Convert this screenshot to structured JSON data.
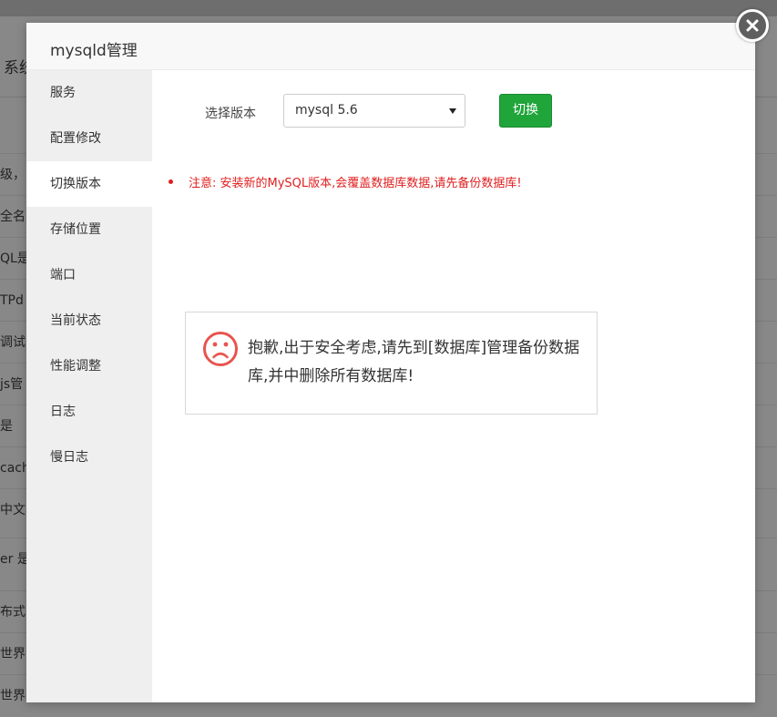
{
  "background": {
    "page_title": "系统",
    "rows": [
      "级，占",
      "全名第",
      "QL是",
      "TPd",
      "调试",
      "js管",
      "是",
      "cach",
      "中文",
      "er 是",
      "布式",
      "世界",
      "世界"
    ]
  },
  "modal": {
    "title": "mysqld管理",
    "close_icon": "close-icon"
  },
  "sidebar": {
    "items": [
      {
        "label": "服务",
        "active": false
      },
      {
        "label": "配置修改",
        "active": false
      },
      {
        "label": "切换版本",
        "active": true
      },
      {
        "label": "存储位置",
        "active": false
      },
      {
        "label": "端口",
        "active": false
      },
      {
        "label": "当前状态",
        "active": false
      },
      {
        "label": "性能调整",
        "active": false
      },
      {
        "label": "日志",
        "active": false
      },
      {
        "label": "慢日志",
        "active": false
      }
    ]
  },
  "main": {
    "version_label": "选择版本",
    "version_selected": "mysql 5.6",
    "switch_button": "切换",
    "warning": "注意: 安装新的MySQL版本,会覆盖数据库数据,请先备份数据库!",
    "notice": "抱歉,出于安全考虑,请先到[数据库]管理备份数据库,并中删除所有数据库!"
  },
  "colors": {
    "accent_green": "#20a53a",
    "warning_red": "#e01e1e",
    "sad_icon": "#e8544e"
  }
}
